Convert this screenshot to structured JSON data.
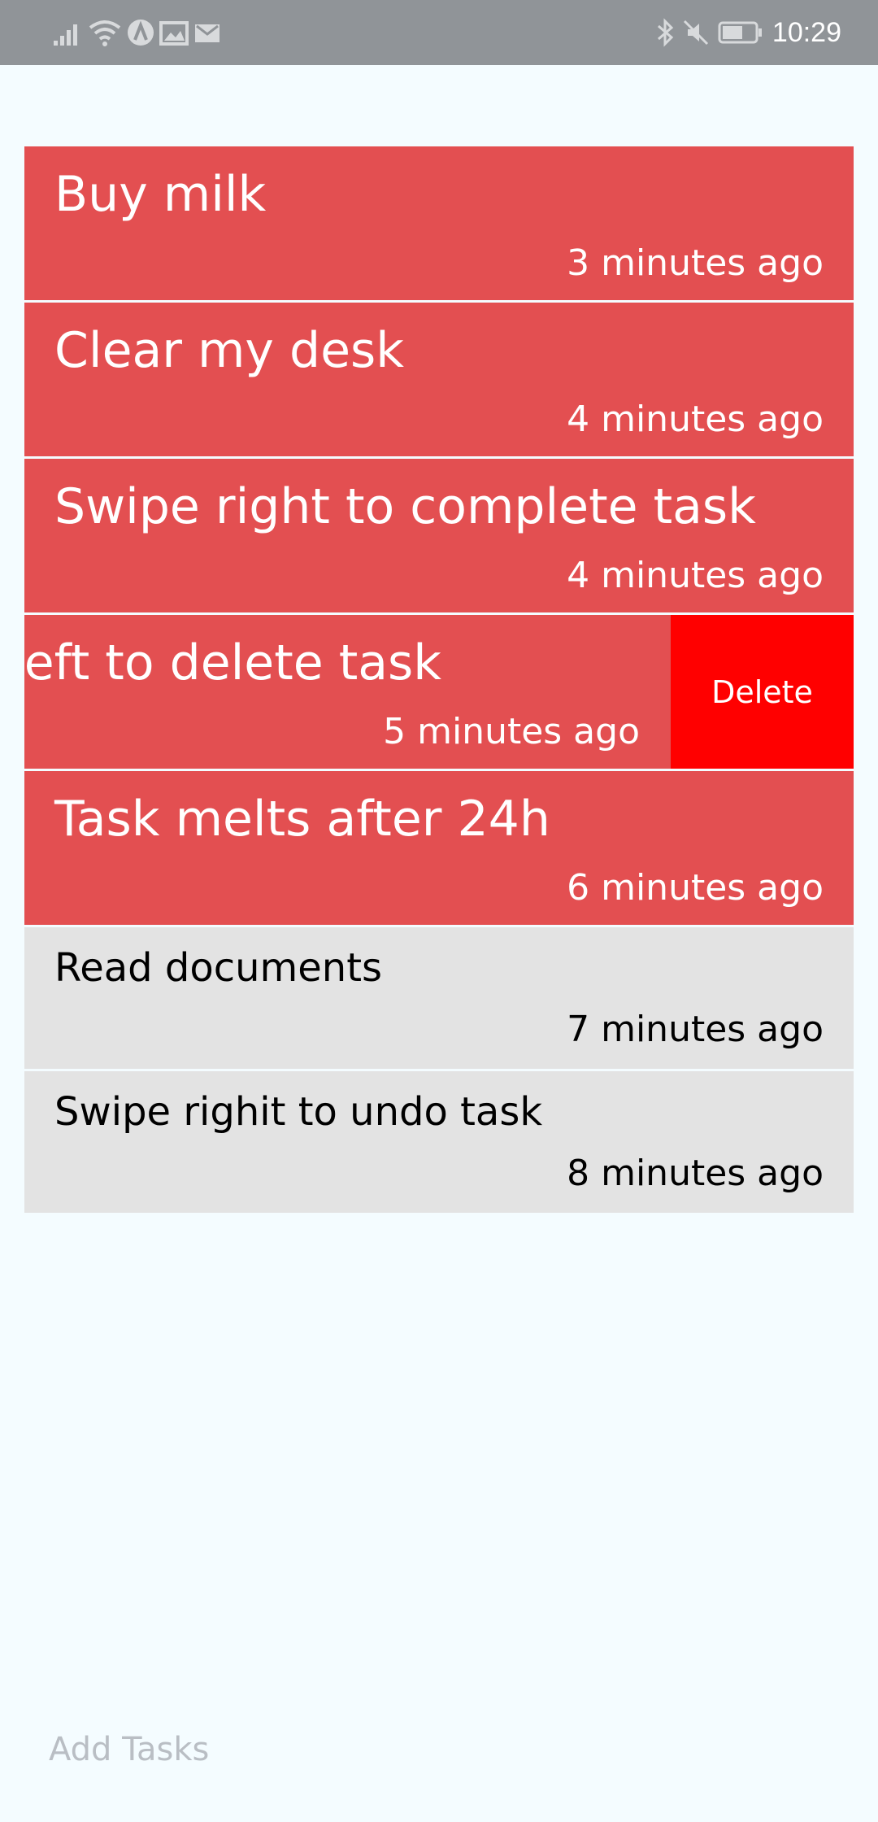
{
  "status_bar": {
    "time": "10:29",
    "icons": [
      "signal-icon",
      "wifi-icon",
      "app-notification-icon",
      "gallery-notification-icon",
      "mail-notification-icon",
      "bluetooth-icon",
      "mute-icon",
      "battery-icon"
    ]
  },
  "tasks": [
    {
      "title": "Buy milk",
      "time": "3 minutes ago",
      "state": "active"
    },
    {
      "title": "Clear my desk",
      "time": "4 minutes ago",
      "state": "active"
    },
    {
      "title": "Swipe right to complete task",
      "time": "4 minutes ago",
      "state": "active"
    },
    {
      "title": "left to delete task",
      "time": "5 minutes ago",
      "state": "swiped",
      "action_label": "Delete"
    },
    {
      "title": "Task melts after 24h",
      "time": "6 minutes ago",
      "state": "active"
    },
    {
      "title": "Read documents",
      "time": "7 minutes ago",
      "state": "done"
    },
    {
      "title": "Swipe righit to undo task",
      "time": "8 minutes ago",
      "state": "done"
    }
  ],
  "input": {
    "placeholder": "Add Tasks",
    "value": ""
  },
  "colors": {
    "active_task": "#e34f51",
    "done_task": "#e3e3e3",
    "delete_action": "#ff0000",
    "background": "#f4fcff",
    "status_bar": "#909498"
  }
}
